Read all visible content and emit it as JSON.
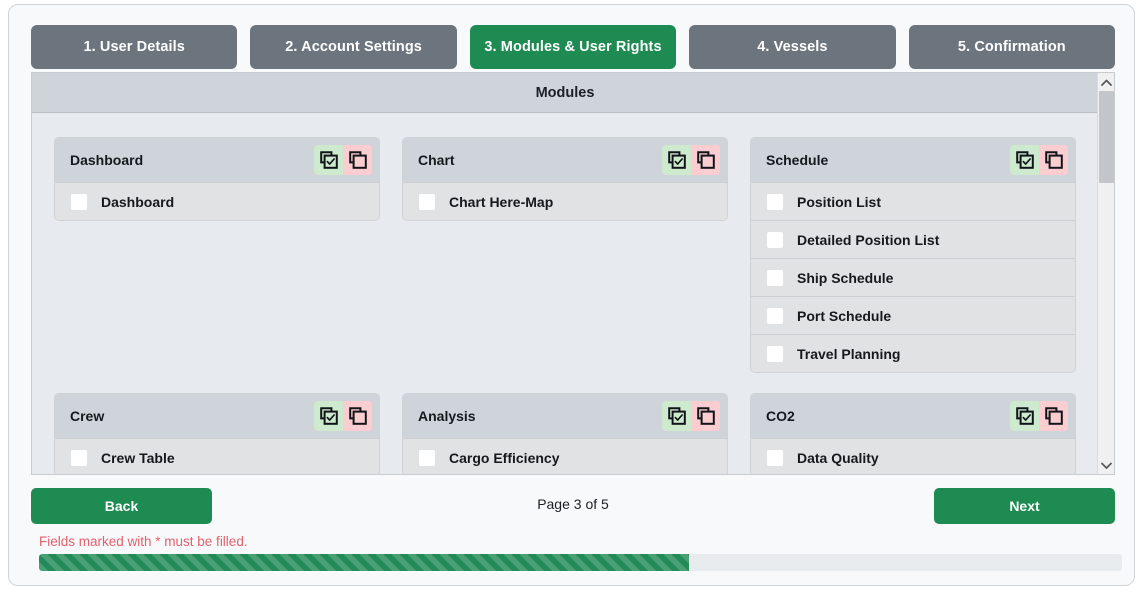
{
  "wizard": {
    "steps": [
      {
        "label": "1. User Details",
        "active": false
      },
      {
        "label": "2. Account Settings",
        "active": false
      },
      {
        "label": "3. Modules & User Rights",
        "active": true
      },
      {
        "label": "4. Vessels",
        "active": false
      },
      {
        "label": "5. Confirmation",
        "active": false
      }
    ],
    "section_title": "Modules",
    "page_indicator": "Page 3 of 5",
    "back_label": "Back",
    "next_label": "Next",
    "validation_message": "Fields marked with * must be filled.",
    "progress_percent": 60
  },
  "icons": {
    "select_all": "select-all-icon",
    "deselect_all": "deselect-all-icon",
    "scroll_up": "chevron-up-icon",
    "scroll_down": "chevron-down-icon"
  },
  "colors": {
    "accent_green": "#1e8b52",
    "tab_inactive": "#6c757d",
    "panel_header": "#ced4da",
    "row_background": "#e0e2e4",
    "content_background": "#e7eaee",
    "select_all_background": "#cdeace",
    "deselect_all_background": "#fbcdd1",
    "error_text": "#e4606d"
  },
  "modules": [
    {
      "title": "Dashboard",
      "items": [
        {
          "label": "Dashboard",
          "checked": false
        }
      ]
    },
    {
      "title": "Chart",
      "items": [
        {
          "label": "Chart Here-Map",
          "checked": false
        }
      ]
    },
    {
      "title": "Schedule",
      "items": [
        {
          "label": "Position List",
          "checked": false
        },
        {
          "label": "Detailed Position List",
          "checked": false
        },
        {
          "label": "Ship Schedule",
          "checked": false
        },
        {
          "label": "Port Schedule",
          "checked": false
        },
        {
          "label": "Travel Planning",
          "checked": false
        }
      ]
    },
    {
      "title": "Crew",
      "items": [
        {
          "label": "Crew Table",
          "checked": false
        }
      ]
    },
    {
      "title": "Analysis",
      "items": [
        {
          "label": "Cargo Efficiency",
          "checked": false
        }
      ]
    },
    {
      "title": "CO2",
      "items": [
        {
          "label": "Data Quality",
          "checked": false
        }
      ]
    }
  ]
}
